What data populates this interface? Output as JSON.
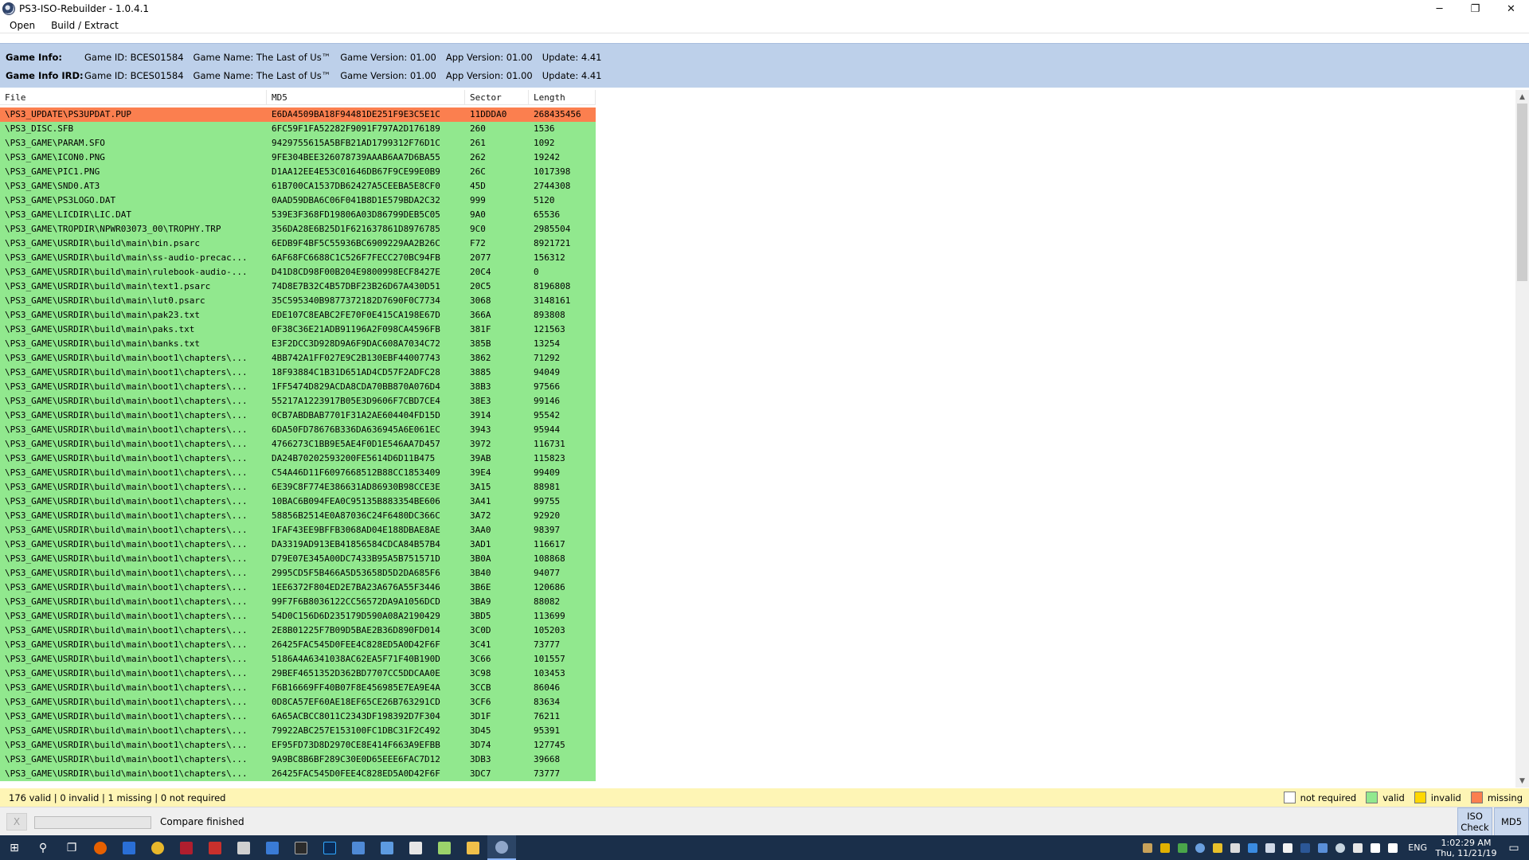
{
  "window": {
    "title": "PS3-ISO-Rebuilder - 1.0.4.1",
    "minimize": "─",
    "maximize": "❐",
    "close": "✕"
  },
  "menu": [
    {
      "label": "Open"
    },
    {
      "label": "Build / Extract"
    }
  ],
  "game_info": {
    "label": "Game Info:",
    "fields": [
      "Game ID: BCES01584",
      "Game Name: The Last of Us™",
      "Game Version: 01.00",
      "App Version: 01.00",
      "Update: 4.41"
    ]
  },
  "game_info_ird": {
    "label": "Game Info IRD:",
    "fields": [
      "Game ID: BCES01584",
      "Game Name: The Last of Us™",
      "Game Version: 01.00",
      "App Version: 01.00",
      "Update: 4.41"
    ]
  },
  "table": {
    "columns": [
      "File",
      "MD5",
      "Sector",
      "Length"
    ],
    "rows": [
      {
        "file": "\\PS3_UPDATE\\PS3UPDAT.PUP",
        "md5": "E6DA4509BA18F94481DE251F9E3C5E1C",
        "sector": "11DDDA0",
        "length": "268435456",
        "status": "missing"
      },
      {
        "file": "\\PS3_DISC.SFB",
        "md5": "6FC59F1FA52282F9091F797A2D176189",
        "sector": "260",
        "length": "1536",
        "status": "valid"
      },
      {
        "file": "\\PS3_GAME\\PARAM.SFO",
        "md5": "9429755615A5BFB21AD1799312F76D1C",
        "sector": "261",
        "length": "1092",
        "status": "valid"
      },
      {
        "file": "\\PS3_GAME\\ICON0.PNG",
        "md5": "9FE304BEE326078739AAAB6AA7D6BA55",
        "sector": "262",
        "length": "19242",
        "status": "valid"
      },
      {
        "file": "\\PS3_GAME\\PIC1.PNG",
        "md5": "D1AA12EE4E53C01646DB67F9CE99E0B9",
        "sector": "26C",
        "length": "1017398",
        "status": "valid"
      },
      {
        "file": "\\PS3_GAME\\SND0.AT3",
        "md5": "61B700CA1537DB62427A5CEEBA5E8CF0",
        "sector": "45D",
        "length": "2744308",
        "status": "valid"
      },
      {
        "file": "\\PS3_GAME\\PS3LOGO.DAT",
        "md5": "0AAD59DBA6C06F041B8D1E579BDA2C32",
        "sector": "999",
        "length": "5120",
        "status": "valid"
      },
      {
        "file": "\\PS3_GAME\\LICDIR\\LIC.DAT",
        "md5": "539E3F368FD19806A03D86799DEB5C05",
        "sector": "9A0",
        "length": "65536",
        "status": "valid"
      },
      {
        "file": "\\PS3_GAME\\TROPDIR\\NPWR03073_00\\TROPHY.TRP",
        "md5": "356DA28E6B25D1F621637861D8976785",
        "sector": "9C0",
        "length": "2985504",
        "status": "valid"
      },
      {
        "file": "\\PS3_GAME\\USRDIR\\build\\main\\bin.psarc",
        "md5": "6EDB9F4BF5C55936BC6909229AA2B26C",
        "sector": "F72",
        "length": "8921721",
        "status": "valid"
      },
      {
        "file": "\\PS3_GAME\\USRDIR\\build\\main\\ss-audio-precac...",
        "md5": "6AF68FC6688C1C526F7FECC270BC94FB",
        "sector": "2077",
        "length": "156312",
        "status": "valid"
      },
      {
        "file": "\\PS3_GAME\\USRDIR\\build\\main\\rulebook-audio-...",
        "md5": "D41D8CD98F00B204E9800998ECF8427E",
        "sector": "20C4",
        "length": "0",
        "status": "valid"
      },
      {
        "file": "\\PS3_GAME\\USRDIR\\build\\main\\text1.psarc",
        "md5": "74D8E7B32C4B57DBF23B26D67A430D51",
        "sector": "20C5",
        "length": "8196808",
        "status": "valid"
      },
      {
        "file": "\\PS3_GAME\\USRDIR\\build\\main\\lut0.psarc",
        "md5": "35C595340B9877372182D7690F0C7734",
        "sector": "3068",
        "length": "3148161",
        "status": "valid"
      },
      {
        "file": "\\PS3_GAME\\USRDIR\\build\\main\\pak23.txt",
        "md5": "EDE107C8EABC2FE70F0E415CA198E67D",
        "sector": "366A",
        "length": "893808",
        "status": "valid"
      },
      {
        "file": "\\PS3_GAME\\USRDIR\\build\\main\\paks.txt",
        "md5": "0F38C36E21ADB91196A2F098CA4596FB",
        "sector": "381F",
        "length": "121563",
        "status": "valid"
      },
      {
        "file": "\\PS3_GAME\\USRDIR\\build\\main\\banks.txt",
        "md5": "E3F2DCC3D928D9A6F9DAC608A7034C72",
        "sector": "385B",
        "length": "13254",
        "status": "valid"
      },
      {
        "file": "\\PS3_GAME\\USRDIR\\build\\main\\boot1\\chapters\\...",
        "md5": "4BB742A1FF027E9C2B130EBF44007743",
        "sector": "3862",
        "length": "71292",
        "status": "valid"
      },
      {
        "file": "\\PS3_GAME\\USRDIR\\build\\main\\boot1\\chapters\\...",
        "md5": "18F93884C1B31D651AD4CD57F2ADFC28",
        "sector": "3885",
        "length": "94049",
        "status": "valid"
      },
      {
        "file": "\\PS3_GAME\\USRDIR\\build\\main\\boot1\\chapters\\...",
        "md5": "1FF5474D829ACDA8CDA70BB870A076D4",
        "sector": "38B3",
        "length": "97566",
        "status": "valid"
      },
      {
        "file": "\\PS3_GAME\\USRDIR\\build\\main\\boot1\\chapters\\...",
        "md5": "55217A1223917B05E3D9606F7CBD7CE4",
        "sector": "38E3",
        "length": "99146",
        "status": "valid"
      },
      {
        "file": "\\PS3_GAME\\USRDIR\\build\\main\\boot1\\chapters\\...",
        "md5": "0CB7ABDBAB7701F31A2AE604404FD15D",
        "sector": "3914",
        "length": "95542",
        "status": "valid"
      },
      {
        "file": "\\PS3_GAME\\USRDIR\\build\\main\\boot1\\chapters\\...",
        "md5": "6DA50FD78676B336DA636945A6E061EC",
        "sector": "3943",
        "length": "95944",
        "status": "valid"
      },
      {
        "file": "\\PS3_GAME\\USRDIR\\build\\main\\boot1\\chapters\\...",
        "md5": "4766273C1BB9E5AE4F0D1E546AA7D457",
        "sector": "3972",
        "length": "116731",
        "status": "valid"
      },
      {
        "file": "\\PS3_GAME\\USRDIR\\build\\main\\boot1\\chapters\\...",
        "md5": "DA24B70202593200FE5614D6D11B475",
        "sector": "39AB",
        "length": "115823",
        "status": "valid"
      },
      {
        "file": "\\PS3_GAME\\USRDIR\\build\\main\\boot1\\chapters\\...",
        "md5": "C54A46D11F6097668512B88CC1853409",
        "sector": "39E4",
        "length": "99409",
        "status": "valid"
      },
      {
        "file": "\\PS3_GAME\\USRDIR\\build\\main\\boot1\\chapters\\...",
        "md5": "6E39C8F774E386631AD86930B98CCE3E",
        "sector": "3A15",
        "length": "88981",
        "status": "valid"
      },
      {
        "file": "\\PS3_GAME\\USRDIR\\build\\main\\boot1\\chapters\\...",
        "md5": "10BAC6B094FEA0C95135B883354BE606",
        "sector": "3A41",
        "length": "99755",
        "status": "valid"
      },
      {
        "file": "\\PS3_GAME\\USRDIR\\build\\main\\boot1\\chapters\\...",
        "md5": "58856B2514E0A87036C24F6480DC366C",
        "sector": "3A72",
        "length": "92920",
        "status": "valid"
      },
      {
        "file": "\\PS3_GAME\\USRDIR\\build\\main\\boot1\\chapters\\...",
        "md5": "1FAF43EE9BFFB3068AD04E188DBAE8AE",
        "sector": "3AA0",
        "length": "98397",
        "status": "valid"
      },
      {
        "file": "\\PS3_GAME\\USRDIR\\build\\main\\boot1\\chapters\\...",
        "md5": "DA3319AD913EB41856584CDCA84B57B4",
        "sector": "3AD1",
        "length": "116617",
        "status": "valid"
      },
      {
        "file": "\\PS3_GAME\\USRDIR\\build\\main\\boot1\\chapters\\...",
        "md5": "D79E07E345A00DC7433B95A5B751571D",
        "sector": "3B0A",
        "length": "108868",
        "status": "valid"
      },
      {
        "file": "\\PS3_GAME\\USRDIR\\build\\main\\boot1\\chapters\\...",
        "md5": "2995CD5F5B466A5D53658D5D2DA685F6",
        "sector": "3B40",
        "length": "94077",
        "status": "valid"
      },
      {
        "file": "\\PS3_GAME\\USRDIR\\build\\main\\boot1\\chapters\\...",
        "md5": "1EE6372F804ED2E7BA23A676A55F3446",
        "sector": "3B6E",
        "length": "120686",
        "status": "valid"
      },
      {
        "file": "\\PS3_GAME\\USRDIR\\build\\main\\boot1\\chapters\\...",
        "md5": "99F7F6B8036122CC56572DA9A1056DCD",
        "sector": "3BA9",
        "length": "88082",
        "status": "valid"
      },
      {
        "file": "\\PS3_GAME\\USRDIR\\build\\main\\boot1\\chapters\\...",
        "md5": "54D0C156D6D235179D590A08A2190429",
        "sector": "3BD5",
        "length": "113699",
        "status": "valid"
      },
      {
        "file": "\\PS3_GAME\\USRDIR\\build\\main\\boot1\\chapters\\...",
        "md5": "2E8B01225F7B09D5BAE2B36D890FD014",
        "sector": "3C0D",
        "length": "105203",
        "status": "valid"
      },
      {
        "file": "\\PS3_GAME\\USRDIR\\build\\main\\boot1\\chapters\\...",
        "md5": "26425FAC545D0FEE4C828ED5A0D42F6F",
        "sector": "3C41",
        "length": "73777",
        "status": "valid"
      },
      {
        "file": "\\PS3_GAME\\USRDIR\\build\\main\\boot1\\chapters\\...",
        "md5": "5186A4A6341038AC62EA5F71F40B190D",
        "sector": "3C66",
        "length": "101557",
        "status": "valid"
      },
      {
        "file": "\\PS3_GAME\\USRDIR\\build\\main\\boot1\\chapters\\...",
        "md5": "29BEF4651352D362BD7707CC5DDCAA0E",
        "sector": "3C98",
        "length": "103453",
        "status": "valid"
      },
      {
        "file": "\\PS3_GAME\\USRDIR\\build\\main\\boot1\\chapters\\...",
        "md5": "F6B16669FF40B07F8E456985E7EA9E4A",
        "sector": "3CCB",
        "length": "86046",
        "status": "valid"
      },
      {
        "file": "\\PS3_GAME\\USRDIR\\build\\main\\boot1\\chapters\\...",
        "md5": "0D8CA57EF60AE18EF65CE26B763291CD",
        "sector": "3CF6",
        "length": "83634",
        "status": "valid"
      },
      {
        "file": "\\PS3_GAME\\USRDIR\\build\\main\\boot1\\chapters\\...",
        "md5": "6A65ACBCC8011C2343DF198392D7F304",
        "sector": "3D1F",
        "length": "76211",
        "status": "valid"
      },
      {
        "file": "\\PS3_GAME\\USRDIR\\build\\main\\boot1\\chapters\\...",
        "md5": "79922ABC257E153100FC1DBC31F2C492",
        "sector": "3D45",
        "length": "95391",
        "status": "valid"
      },
      {
        "file": "\\PS3_GAME\\USRDIR\\build\\main\\boot1\\chapters\\...",
        "md5": "EF95FD73D8D2970CE8E414F663A9EFBB",
        "sector": "3D74",
        "length": "127745",
        "status": "valid"
      },
      {
        "file": "\\PS3_GAME\\USRDIR\\build\\main\\boot1\\chapters\\...",
        "md5": "9A9BC8B6BF289C30E0D65EEE6FAC7D12",
        "sector": "3DB3",
        "length": "39668",
        "status": "valid"
      },
      {
        "file": "\\PS3_GAME\\USRDIR\\build\\main\\boot1\\chapters\\...",
        "md5": "26425FAC545D0FEE4C828ED5A0D42F6F",
        "sector": "3DC7",
        "length": "73777",
        "status": "valid"
      }
    ]
  },
  "status": {
    "summary": "176 valid | 0 invalid | 1 missing | 0 not required",
    "legend": [
      {
        "label": "not required",
        "color": "#ffffff"
      },
      {
        "label": "valid",
        "color": "#91e88e"
      },
      {
        "label": "invalid",
        "color": "#ffd700"
      },
      {
        "label": "missing",
        "color": "#fb7f4f"
      }
    ]
  },
  "bottom": {
    "cancel_label": "X",
    "progress": 0,
    "compare_status": "Compare finished",
    "iso_check_label": "ISO Check",
    "md5_label": "MD5"
  },
  "taskbar": {
    "language": "ENG",
    "time": "1:02:29 AM",
    "date": "Thu, 11/21/19"
  },
  "colors": {
    "valid": "#91e88e",
    "missing": "#fb7f4f",
    "info_bg": "#bdd0ea",
    "status_bg": "#fef5b5"
  }
}
